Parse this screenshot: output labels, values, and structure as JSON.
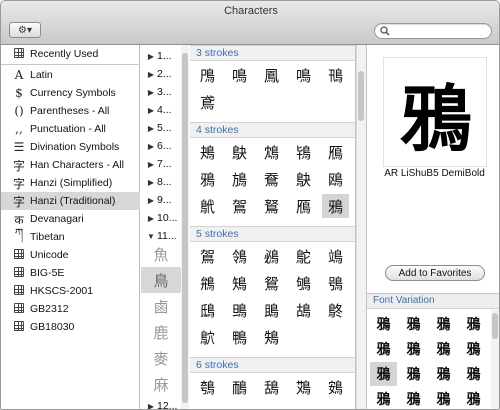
{
  "window": {
    "title": "Characters"
  },
  "toolbar": {
    "gear_label": "⚙▾",
    "search_value": "",
    "search_placeholder": ""
  },
  "sidebar": {
    "recently_used": "Recently Used",
    "items": [
      {
        "icon": "A",
        "label": "Latin"
      },
      {
        "icon": "$",
        "label": "Currency Symbols"
      },
      {
        "icon": "()",
        "label": "Parentheses - All"
      },
      {
        "icon": ",,",
        "label": "Punctuation - All"
      },
      {
        "icon": "☰",
        "label": "Divination Symbols"
      },
      {
        "icon": "字",
        "label": "Han Characters - All"
      },
      {
        "icon": "字",
        "label": "Hanzi (Simplified)"
      },
      {
        "icon": "字",
        "label": "Hanzi (Traditional)",
        "selected": true
      },
      {
        "icon": "क",
        "label": "Devanagari"
      },
      {
        "icon": "ཀ",
        "label": "Tibetan"
      },
      {
        "icon": "grid",
        "label": "Unicode"
      },
      {
        "icon": "grid",
        "label": "BIG-5E"
      },
      {
        "icon": "grid",
        "label": "HKSCS-2001"
      },
      {
        "icon": "grid",
        "label": "GB2312"
      },
      {
        "icon": "grid",
        "label": "GB18030"
      }
    ]
  },
  "radicals": {
    "rows": [
      "1...",
      "2...",
      "3...",
      "4...",
      "5...",
      "6...",
      "7...",
      "8...",
      "9...",
      "10...",
      "11..."
    ],
    "chars": [
      "魚",
      "鳥",
      "鹵",
      "鹿",
      "麥",
      "麻"
    ],
    "selected_char_index": 1,
    "last_row": "12..."
  },
  "characters": {
    "sections": [
      {
        "header": "3 strokes",
        "chars": [
          "鳲",
          "鳴",
          "鳳",
          "鳴",
          "鳵",
          "鳶"
        ]
      },
      {
        "header": "4 strokes",
        "chars": [
          "鴂",
          "鴃",
          "鴆",
          "鴇",
          "鴈",
          "鴉",
          "鴋",
          "鴌",
          "鴃",
          "鴎",
          "鴏",
          "鴐",
          "鴑",
          "鴈",
          "鴉"
        ],
        "selected_index": 14
      },
      {
        "header": "5 strokes",
        "chars": [
          "鴐",
          "鴒",
          "鴓",
          "鴕",
          "鴗",
          "鴘",
          "鴙",
          "鴛",
          "鴝",
          "鴞",
          "鴟",
          "鴠",
          "鴡",
          "鴣",
          "鴤",
          "鴥",
          "鴨",
          "鴩"
        ]
      },
      {
        "header": "6 strokes",
        "chars": [
          "鴮",
          "鴯",
          "鴰",
          "鴱",
          "鴳"
        ]
      }
    ]
  },
  "preview": {
    "char": "鴉",
    "font_name": "AR LiShuB5 DemiBold",
    "favorites_label": "Add to Favorites"
  },
  "font_variation": {
    "header": "Font Variation",
    "cells": [
      "鴉",
      "鴉",
      "鴉",
      "鴉",
      "鴉",
      "鴉",
      "鴉",
      "鴉",
      "鴉",
      "鴉",
      "鴉",
      "鴉",
      "鴉",
      "鴉",
      "鴉",
      "鴉"
    ],
    "selected_index": 8
  }
}
